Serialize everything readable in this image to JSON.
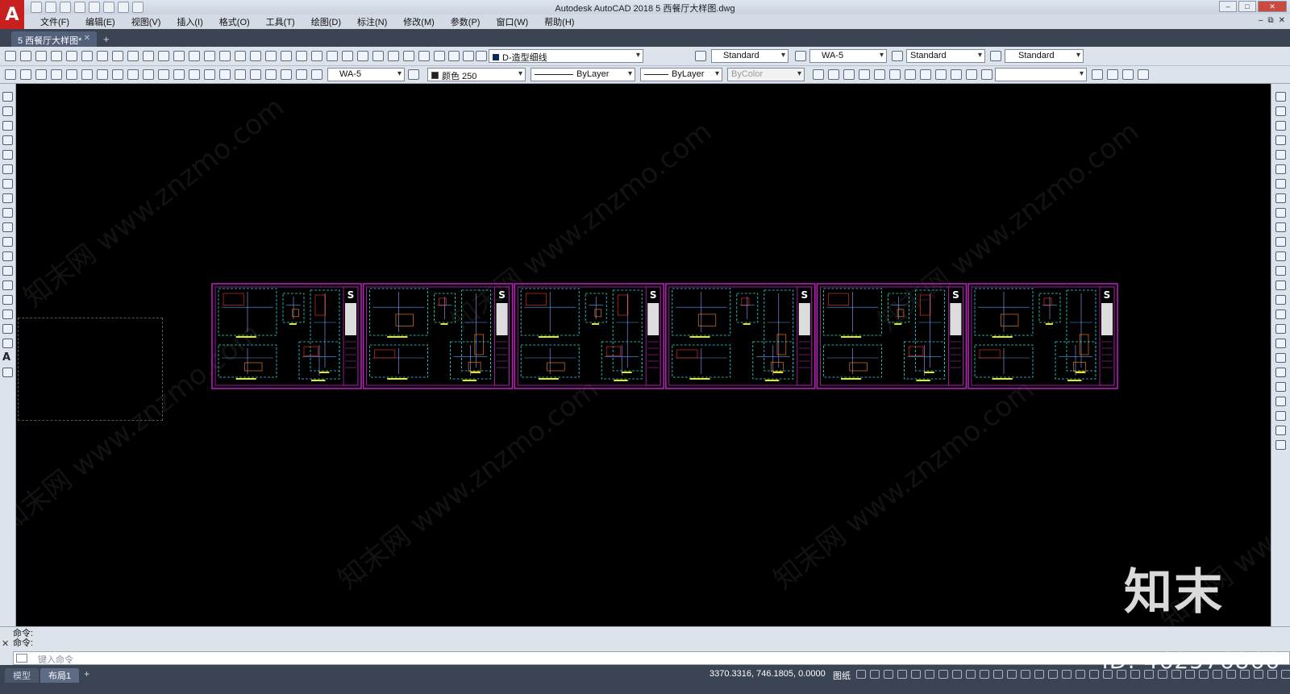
{
  "app": {
    "title": "Autodesk AutoCAD 2018     5 西餐厅大样图.dwg",
    "logo": "A"
  },
  "menu": [
    "文件(F)",
    "编辑(E)",
    "视图(V)",
    "插入(I)",
    "格式(O)",
    "工具(T)",
    "绘图(D)",
    "标注(N)",
    "修改(M)",
    "参数(P)",
    "窗口(W)",
    "帮助(H)"
  ],
  "file_tab": {
    "label": "5 西餐厅大样图*"
  },
  "toolbar": {
    "layer": "D-造型细线",
    "text_style": "Standard",
    "dim_style": "WA-5",
    "table_style": "Standard",
    "multileader_style": "Standard",
    "dim_style2": "WA-5",
    "color": "颜色 250",
    "linetype": "ByLayer",
    "lineweight": "ByLayer",
    "plotstyle": "ByColor"
  },
  "command": {
    "history": [
      "命令:",
      "命令:"
    ],
    "placeholder": "键入命令"
  },
  "status": {
    "layout_tabs": [
      "模型",
      "布局1"
    ],
    "active_tab": "布局1",
    "coords": "3370.3316, 746.1805, 0.0000",
    "space": "图纸"
  },
  "overlay": {
    "brand": "知末",
    "id": "ID: 462576866",
    "watermark": "知末网 www.znzmo.com"
  },
  "sheets": [
    {
      "badge": "S"
    },
    {
      "badge": "S"
    },
    {
      "badge": "S"
    },
    {
      "badge": "S"
    },
    {
      "badge": "S"
    },
    {
      "badge": "S"
    }
  ],
  "colors": {
    "sheet_border": "#c21fc2",
    "detail_line": "#2fd9d9",
    "accent_red": "#e02828",
    "accent_yellow": "#e8e81a",
    "accent_orange": "#e07a20"
  }
}
